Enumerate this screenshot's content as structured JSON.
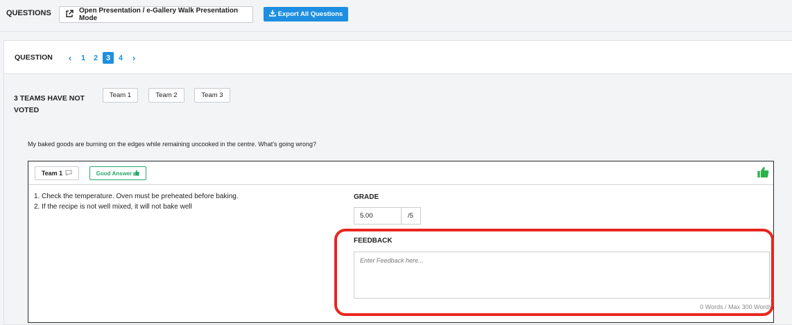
{
  "header": {
    "title": "QUESTIONS",
    "presentation_button": "Open Presentation / e-Gallery Walk Presentation Mode",
    "export_button": "Export All Questions"
  },
  "question_nav": {
    "label": "QUESTION",
    "pages": [
      "1",
      "2",
      "3",
      "4"
    ],
    "current_page": "3"
  },
  "voting": {
    "status": "3 TEAMS HAVE NOT VOTED",
    "teams": [
      "Team 1",
      "Team 2",
      "Team 3"
    ]
  },
  "question_text": "My baked goods are burning on the edges while remaining uncooked in the centre. What's going wrong?",
  "answer_card": {
    "team": "Team 1",
    "good_answer_label": "Good Answer",
    "answer_lines": [
      "1. Check the temperature. Oven must be preheated before baking.",
      "2. If the recipe is not well mixed, it will not bake well"
    ],
    "grade_label": "GRADE",
    "grade_value": "5.00",
    "grade_max": "/5",
    "feedback_label": "FEEDBACK",
    "feedback_placeholder": "Enter Feedback here...",
    "word_count": "0 Words / Max 300 Words"
  },
  "colors": {
    "primary": "#1e8fe0",
    "success": "#27a86a",
    "highlight": "#e8261e"
  }
}
